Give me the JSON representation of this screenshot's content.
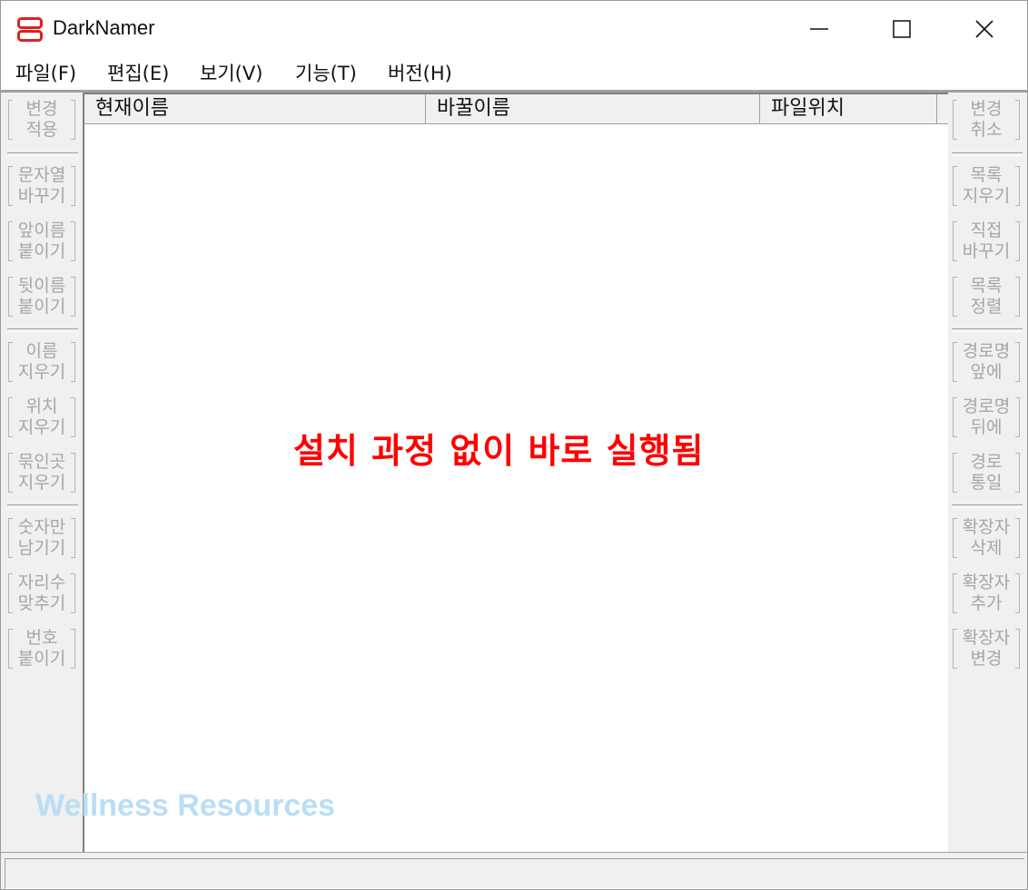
{
  "window": {
    "title": "DarkNamer",
    "controls": {
      "minimize_icon": "minimize-icon",
      "maximize_icon": "maximize-icon",
      "close_icon": "close-icon"
    }
  },
  "menu": [
    {
      "label": "파일(F)"
    },
    {
      "label": "편집(E)"
    },
    {
      "label": "보기(V)"
    },
    {
      "label": "기능(T)"
    },
    {
      "label": "버전(H)"
    }
  ],
  "left_buttons": [
    {
      "line1": "변경",
      "line2": "적용"
    },
    {
      "line1": "문자열",
      "line2": "바꾸기"
    },
    {
      "line1": "앞이름",
      "line2": "붙이기"
    },
    {
      "line1": "뒷이름",
      "line2": "붙이기"
    },
    {
      "line1": "이름",
      "line2": "지우기"
    },
    {
      "line1": "위치",
      "line2": "지우기"
    },
    {
      "line1": "묶인곳",
      "line2": "지우기"
    },
    {
      "line1": "숫자만",
      "line2": "남기기"
    },
    {
      "line1": "자리수",
      "line2": "맞추기"
    },
    {
      "line1": "번호",
      "line2": "붙이기"
    }
  ],
  "right_buttons": [
    {
      "line1": "변경",
      "line2": "취소"
    },
    {
      "line1": "목록",
      "line2": "지우기"
    },
    {
      "line1": "직접",
      "line2": "바꾸기"
    },
    {
      "line1": "목록",
      "line2": "정렬"
    },
    {
      "line1": "경로명",
      "line2": "앞에"
    },
    {
      "line1": "경로명",
      "line2": "뒤에"
    },
    {
      "line1": "경로",
      "line2": "통일"
    },
    {
      "line1": "확장자",
      "line2": "삭제"
    },
    {
      "line1": "확장자",
      "line2": "추가"
    },
    {
      "line1": "확장자",
      "line2": "변경"
    }
  ],
  "list": {
    "columns": [
      {
        "label": "현재이름"
      },
      {
        "label": "바꿀이름"
      },
      {
        "label": "파일위치"
      }
    ]
  },
  "overlay_text": "설치 과정 없이 바로 실행됨",
  "watermark": "Wellness Resources",
  "colors": {
    "overlay": "#ff0000",
    "watermark": "#b9def5",
    "disabled_text": "#a6a6a6",
    "app_icon": "#e02020"
  }
}
